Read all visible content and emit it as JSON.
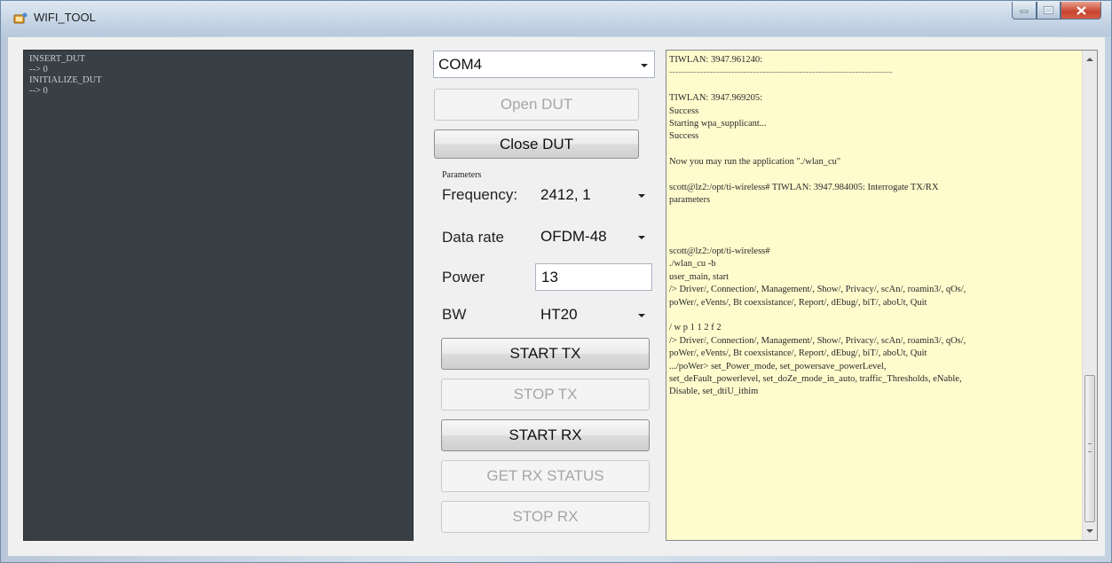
{
  "window": {
    "title": "WIFI_TOOL",
    "icon": "wifi-tool-icon"
  },
  "left_log": {
    "lines": [
      "INSERT_DUT",
      "--> 0",
      "INITIALIZE_DUT",
      "--> 0"
    ]
  },
  "port": {
    "selected": "COM4"
  },
  "buttons": {
    "open_dut": "Open DUT",
    "close_dut": "Close DUT",
    "start_tx": "START  TX",
    "stop_tx": "STOP TX",
    "start_rx": "START RX",
    "get_rx_status": "GET RX STATUS",
    "stop_rx": "STOP RX"
  },
  "parameters": {
    "group_label": "Parameters",
    "frequency_label": "Frequency:",
    "frequency_value": "2412, 1",
    "data_rate_label": "Data rate",
    "data_rate_value": "OFDM-48",
    "power_label": "Power",
    "power_value": "13",
    "bw_label": "BW",
    "bw_value": "HT20"
  },
  "console": {
    "lines": [
      "TIWLAN: 3947.961240:",
      "------------------------------------------------------------------------",
      "",
      "TIWLAN: 3947.969205:",
      "Success",
      "Starting wpa_supplicant...",
      "Success",
      "",
      "Now you may run the application \"./wlan_cu\"",
      "",
      "scott@lz2:/opt/ti-wireless# TIWLAN: 3947.984005: Interrogate TX/RX",
      "parameters",
      "",
      "",
      "",
      "scott@lz2:/opt/ti-wireless#",
      "./wlan_cu -b",
      "user_main, start",
      "/> Driver/, Connection/, Management/, Show/, Privacy/, scAn/, roamin3/, qOs/,",
      "poWer/, eVents/, Bt coexsistance/, Report/, dEbug/, biT/, aboUt, Quit",
      "",
      "/ w p 1 1 2 f 2",
      "/> Driver/, Connection/, Management/, Show/, Privacy/, scAn/, roamin3/, qOs/,",
      "poWer/, eVents/, Bt coexsistance/, Report/, dEbug/, biT/, aboUt, Quit",
      ".../poWer> set_Power_mode, set_powersave_powerLevel,",
      "set_deFault_powerlevel, set_doZe_mode_in_auto, traffic_Thresholds, eNable,",
      "Disable, set_dtiU_ithim"
    ]
  }
}
